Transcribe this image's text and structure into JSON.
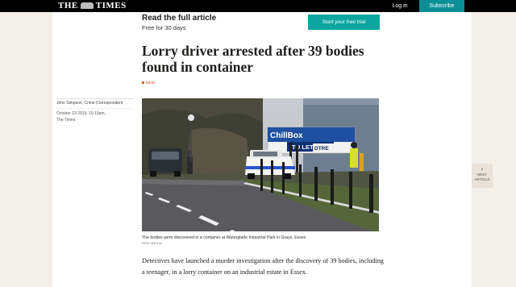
{
  "header": {
    "logo_left": "THE",
    "logo_right": "TIMES",
    "login_label": "Log in",
    "subscribe_label": "Subscribe"
  },
  "promo": {
    "title": "Read the full article",
    "subtitle": "Free for 30 days",
    "trial_button": "Start your free trial"
  },
  "article": {
    "headline": "Lorry driver arrested after 39 bodies found in container",
    "badge": "NEW",
    "author": "John Simpson, Crime Correspondent",
    "date": "October 23 2019, 10:13am,",
    "source": "The Times",
    "image": {
      "sign_brand": "ChillBox",
      "sign_text": "TO LET",
      "sign_code": "DTRE"
    },
    "caption": "The bodies were discovered in a container at Waterglade Industrial Park in Grays, Essex",
    "credit": "BPM MEDIA",
    "body": "Detectives have launched a murder investigation after the discovery of 39 bodies, including a teenager, in a lorry container on an industrial estate in Essex."
  },
  "next_article": {
    "chevron": "›",
    "line1": "NEXT",
    "line2": "ARTICLE"
  },
  "colors": {
    "topbar": "#000000",
    "subscribe": "#0b8f95",
    "trial_button": "#0ca69f",
    "badge": "#c4421a",
    "page_bg": "#f3efe9"
  }
}
